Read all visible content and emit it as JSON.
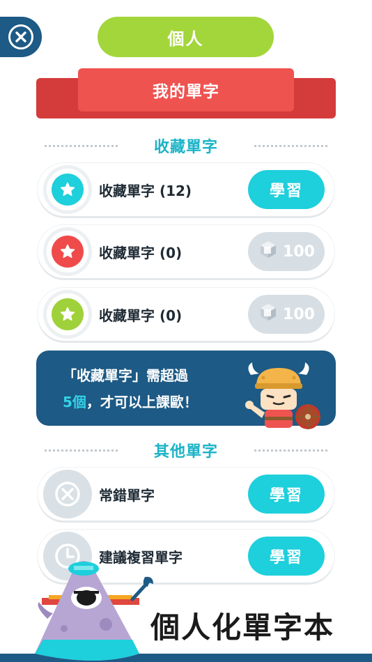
{
  "header": {
    "close_icon": "close-circle-icon",
    "personal_label": "個人",
    "ribbon_title": "我的單字"
  },
  "saved_section": {
    "title": "收藏單字",
    "items": [
      {
        "label": "收藏單字 (12)",
        "color": "#1ecfdc",
        "icon": "star-icon",
        "action_label": "學習",
        "locked": false
      },
      {
        "label": "收藏單字 (0)",
        "color": "#ef4b4b",
        "icon": "star-icon",
        "action_label": "100",
        "locked": true
      },
      {
        "label": "收藏單字 (0)",
        "color": "#9fd13b",
        "icon": "star-icon",
        "action_label": "100",
        "locked": true
      }
    ]
  },
  "notice": {
    "line1": "「收藏單字」需超過",
    "line2_highlight": "5個",
    "line2_rest": "，才可以上課歐！"
  },
  "other_section": {
    "title": "其他單字",
    "items": [
      {
        "label": "常錯單字",
        "icon": "x-circle-icon",
        "action_label": "學習"
      },
      {
        "label": "建議複習單字",
        "icon": "clock-icon",
        "action_label": "學習"
      }
    ]
  },
  "footer": {
    "title": "個人化單字本"
  },
  "colors": {
    "navy": "#1d5a85",
    "green": "#a3d63b",
    "red": "#ef5350",
    "teal": "#1ecfdc",
    "section_title": "#1ab3c7"
  }
}
